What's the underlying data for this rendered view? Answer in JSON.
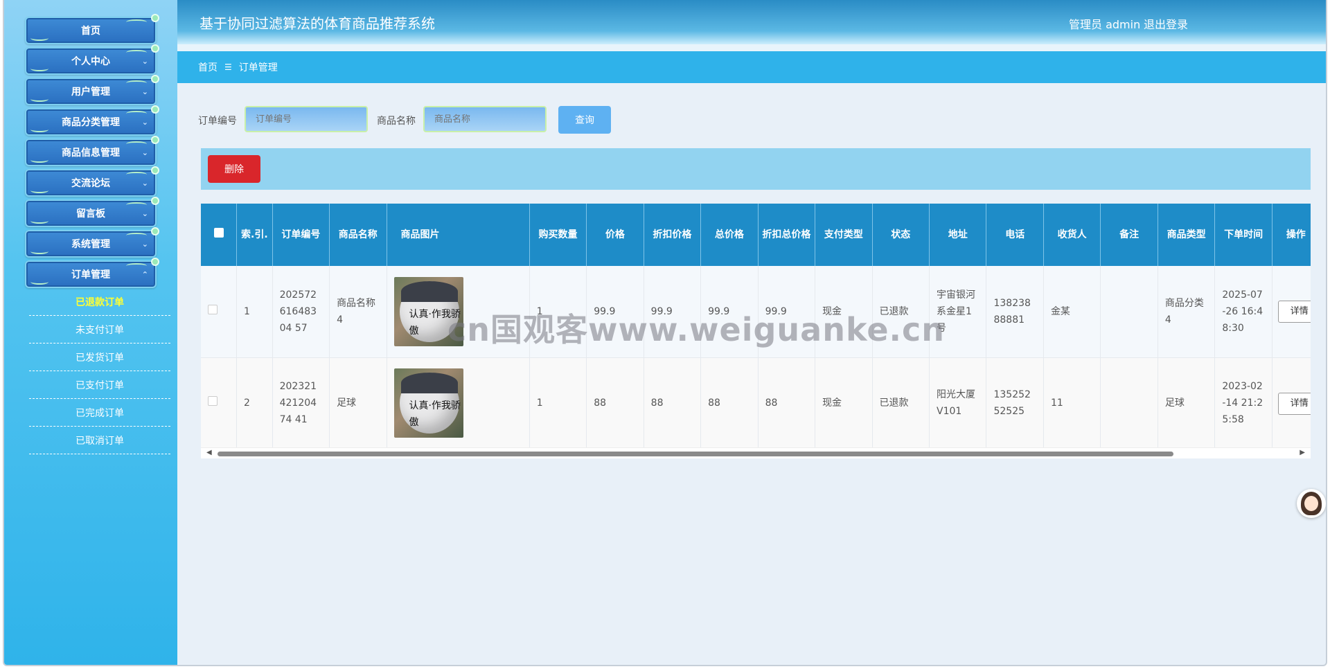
{
  "app": {
    "title": "基于协同过滤算法的体育商品推荐系统",
    "user_label": "管理员 admin",
    "logout": "退出登录"
  },
  "sidebar": {
    "items": [
      {
        "label": "首页"
      },
      {
        "label": "个人中心"
      },
      {
        "label": "用户管理"
      },
      {
        "label": "商品分类管理"
      },
      {
        "label": "商品信息管理"
      },
      {
        "label": "交流论坛"
      },
      {
        "label": "留言板"
      },
      {
        "label": "系统管理"
      },
      {
        "label": "订单管理"
      }
    ],
    "submenu": [
      {
        "label": "已退款订单",
        "active": true
      },
      {
        "label": "未支付订单"
      },
      {
        "label": "已发货订单"
      },
      {
        "label": "已支付订单"
      },
      {
        "label": "已完成订单"
      },
      {
        "label": "已取消订单"
      }
    ]
  },
  "breadcrumb": {
    "home": "首页",
    "separator": "☰",
    "current": "订单管理"
  },
  "search": {
    "order_no_label": "订单编号",
    "order_no_placeholder": "订单编号",
    "goods_name_label": "商品名称",
    "goods_name_placeholder": "商品名称",
    "query_button": "查询"
  },
  "toolbar": {
    "delete_button": "删除"
  },
  "table": {
    "headers": [
      "索.引.",
      "订单编号",
      "商品名称",
      "商品图片",
      "购买数量",
      "价格",
      "折扣价格",
      "总价格",
      "折扣总价格",
      "支付类型",
      "状态",
      "地址",
      "电话",
      "收货人",
      "备注",
      "商品类型",
      "下单时间",
      "操作"
    ],
    "rows": [
      {
        "index": "1",
        "order_no": "20257261648304 57",
        "goods_name": "商品名称4",
        "quantity": "1",
        "price": "99.9",
        "discount_price": "99.9",
        "total": "99.9",
        "discount_total": "99.9",
        "pay_type": "现金",
        "status": "已退款",
        "address": "宇宙银河系金星1号",
        "phone": "13823888881",
        "receiver": "金某",
        "remark": "",
        "goods_type": "商品分类4",
        "time": "2025-07-26 16:48:30",
        "detail_button": "详情"
      },
      {
        "index": "2",
        "order_no": "20232142120474 41",
        "goods_name": "足球",
        "quantity": "1",
        "price": "88",
        "discount_price": "88",
        "total": "88",
        "discount_total": "88",
        "pay_type": "现金",
        "status": "已退款",
        "address": "阳光大厦V101",
        "phone": "13525252525",
        "receiver": "11",
        "remark": "",
        "goods_type": "足球",
        "time": "2023-02-14 21:25:58",
        "detail_button": "详情"
      }
    ]
  },
  "watermark": "cn国观客www.weiguanke.cn",
  "image_ink": "认真·作我骄傲",
  "icons": {
    "checkbox": "checkbox-icon",
    "assistant": "assistant-avatar-icon"
  },
  "colors": {
    "header": "#2a8cc5",
    "breadcrumb": "#2fb2ea",
    "table_header": "#1e8cc8",
    "delete": "#d9262b",
    "query": "#5eb1f2",
    "active_submenu": "#ffff33"
  }
}
